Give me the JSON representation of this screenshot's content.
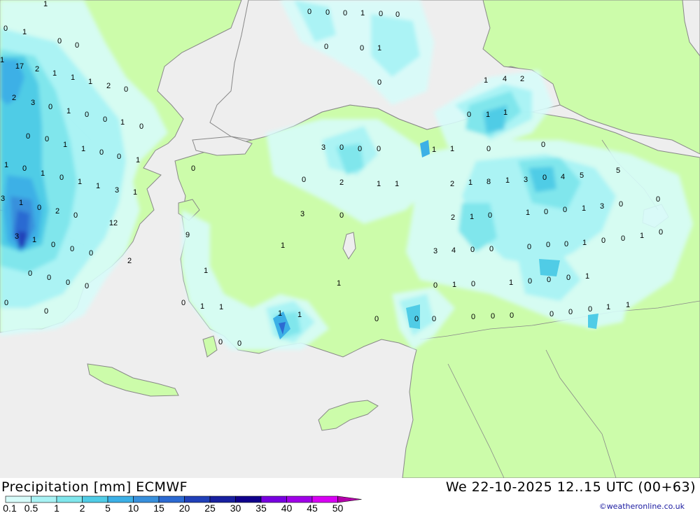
{
  "title": "Precipitation [mm] ECMWF",
  "datetime": "We 22-10-2025 12..15 UTC (00+63)",
  "credit": "©weatheronline.co.uk",
  "colors": {
    "sea": "#eeeeee",
    "land": "#ccfcaa",
    "coast": "#888888",
    "bins": [
      "#d7fcfa",
      "#a8f2f4",
      "#80e6ec",
      "#50cce6",
      "#3cb0e6",
      "#3890dc",
      "#2c6ad2",
      "#2040b8",
      "#1820a0",
      "#10008c",
      "#7800e0",
      "#a000e8",
      "#d800f4",
      "#ee00e8",
      "#b400aa"
    ]
  },
  "legend": {
    "labels": [
      "0.1",
      "0.5",
      "1",
      "2",
      "5",
      "10",
      "15",
      "20",
      "25",
      "30",
      "35",
      "40",
      "45",
      "50"
    ]
  },
  "grid_values": [
    {
      "v": "1"
    },
    {
      "v": "0"
    },
    {
      "v": "1"
    },
    {
      "v": "0"
    },
    {
      "v": "0"
    },
    {
      "v": "0"
    },
    {
      "v": "0"
    },
    {
      "v": "0"
    },
    {
      "v": "1"
    },
    {
      "v": "0"
    },
    {
      "v": "0"
    },
    {
      "v": "1"
    },
    {
      "v": "0"
    },
    {
      "v": "17"
    },
    {
      "v": "2"
    },
    {
      "v": "1"
    },
    {
      "v": "1"
    },
    {
      "v": "1"
    },
    {
      "v": "2"
    },
    {
      "v": "0"
    },
    {
      "v": "0"
    },
    {
      "v": "1"
    },
    {
      "v": "0"
    },
    {
      "v": "2"
    },
    {
      "v": "3"
    },
    {
      "v": "0"
    },
    {
      "v": "1"
    },
    {
      "v": "0"
    },
    {
      "v": "0"
    },
    {
      "v": "1"
    },
    {
      "v": "0"
    },
    {
      "v": "1"
    },
    {
      "v": "4"
    },
    {
      "v": "2"
    },
    {
      "v": "0"
    },
    {
      "v": "1"
    },
    {
      "v": "1"
    },
    {
      "v": "0"
    },
    {
      "v": "0"
    },
    {
      "v": "1"
    },
    {
      "v": "1"
    },
    {
      "v": "0"
    },
    {
      "v": "0"
    },
    {
      "v": "1"
    },
    {
      "v": "3"
    },
    {
      "v": "0"
    },
    {
      "v": "0"
    },
    {
      "v": "0"
    },
    {
      "v": "1"
    },
    {
      "v": "0"
    },
    {
      "v": "1"
    },
    {
      "v": "0"
    },
    {
      "v": "1"
    },
    {
      "v": "1"
    },
    {
      "v": "3"
    },
    {
      "v": "1"
    },
    {
      "v": "1"
    },
    {
      "v": "1"
    },
    {
      "v": "0"
    },
    {
      "v": "0"
    },
    {
      "v": "0"
    },
    {
      "v": "0"
    },
    {
      "v": "2"
    },
    {
      "v": "1"
    },
    {
      "v": "1"
    },
    {
      "v": "2"
    },
    {
      "v": "1"
    },
    {
      "v": "8"
    },
    {
      "v": "1"
    },
    {
      "v": "3"
    },
    {
      "v": "0"
    },
    {
      "v": "4"
    },
    {
      "v": "5"
    },
    {
      "v": "5"
    },
    {
      "v": "3"
    },
    {
      "v": "1"
    },
    {
      "v": "0"
    },
    {
      "v": "2"
    },
    {
      "v": "0"
    },
    {
      "v": "0"
    },
    {
      "v": "0"
    },
    {
      "v": "3"
    },
    {
      "v": "1"
    },
    {
      "v": "0"
    },
    {
      "v": "0"
    },
    {
      "v": "1"
    },
    {
      "v": "3"
    },
    {
      "v": "0"
    },
    {
      "v": "2"
    },
    {
      "v": "1"
    },
    {
      "v": "0"
    },
    {
      "v": "12"
    },
    {
      "v": "9"
    },
    {
      "v": "3"
    },
    {
      "v": "1"
    },
    {
      "v": "0"
    },
    {
      "v": "0"
    },
    {
      "v": "0"
    },
    {
      "v": "1"
    },
    {
      "v": "3"
    },
    {
      "v": "4"
    },
    {
      "v": "0"
    },
    {
      "v": "0"
    },
    {
      "v": "0"
    },
    {
      "v": "0"
    },
    {
      "v": "0"
    },
    {
      "v": "1"
    },
    {
      "v": "0"
    },
    {
      "v": "0"
    },
    {
      "v": "1"
    },
    {
      "v": "0"
    },
    {
      "v": "2"
    },
    {
      "v": "1"
    },
    {
      "v": "0"
    },
    {
      "v": "0"
    },
    {
      "v": "0"
    },
    {
      "v": "0"
    },
    {
      "v": "1"
    },
    {
      "v": "0"
    },
    {
      "v": "1"
    },
    {
      "v": "0"
    },
    {
      "v": "1"
    },
    {
      "v": "0"
    },
    {
      "v": "0"
    },
    {
      "v": "0"
    },
    {
      "v": "1"
    },
    {
      "v": "0"
    },
    {
      "v": "1"
    },
    {
      "v": "1"
    },
    {
      "v": "1"
    },
    {
      "v": "1"
    },
    {
      "v": "0"
    },
    {
      "v": "0"
    },
    {
      "v": "0"
    },
    {
      "v": "0"
    },
    {
      "v": "0"
    },
    {
      "v": "0"
    },
    {
      "v": "0"
    },
    {
      "v": "0"
    },
    {
      "v": "0"
    },
    {
      "v": "0"
    },
    {
      "v": "1"
    },
    {
      "v": "1"
    },
    {
      "v": "0"
    },
    {
      "v": "0"
    },
    {
      "v": "0"
    }
  ]
}
